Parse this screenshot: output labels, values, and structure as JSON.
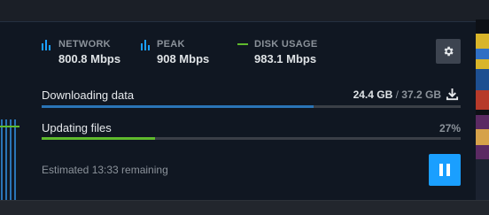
{
  "stats": {
    "network": {
      "label": "NETWORK",
      "value": "800.8 Mbps",
      "icon": "bar-graph-icon"
    },
    "peak": {
      "label": "PEAK",
      "value": "908 Mbps",
      "icon": "bar-graph-icon"
    },
    "disk": {
      "label": "DISK USAGE",
      "value": "983.1 Mbps",
      "icon": "line-icon"
    }
  },
  "download": {
    "label": "Downloading data",
    "current": "24.4 GB",
    "separator": " / ",
    "total": "37.2 GB",
    "progress": 0.65,
    "icon": "download-icon"
  },
  "update": {
    "label": "Updating files",
    "percent": "27%",
    "progress": 0.27
  },
  "remaining": "Estimated 13:33 remaining",
  "settings_icon": "gear-icon",
  "pause_icon": "pause-icon",
  "colors": {
    "accent_blue": "#1a9fff",
    "download_fill": "#2a74b6",
    "update_fill": "#5fba2d",
    "panel_bg": "#101722",
    "muted_text": "#8b929a"
  }
}
